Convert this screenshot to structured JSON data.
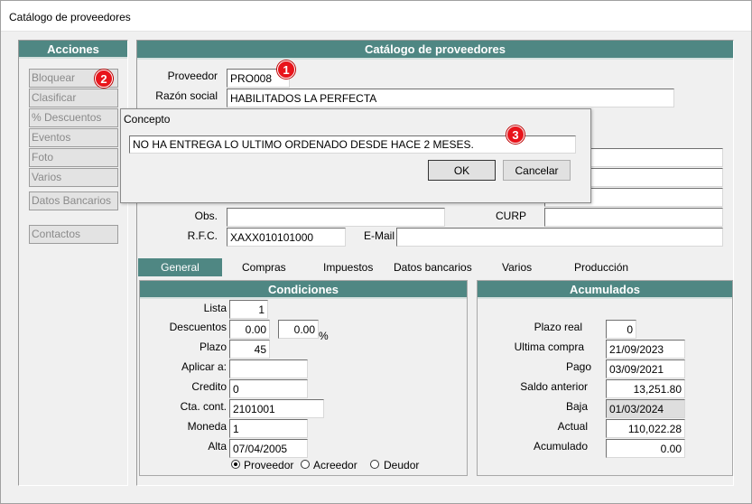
{
  "window": {
    "title": "Catálogo de proveedores"
  },
  "acciones": {
    "title": "Acciones",
    "buttons": [
      "Bloquear",
      "Clasificar",
      "% Descuentos",
      "Eventos",
      "Foto",
      "Varios"
    ],
    "datos_bancarios": "Datos Bancarios",
    "contactos": "Contactos"
  },
  "catalogo": {
    "title": "Catálogo de proveedores",
    "proveedor_label": "Proveedor",
    "proveedor_value": "PRO008",
    "razon_label": "Razón social",
    "razon_value": "HABILITADOS LA PERFECTA",
    "obs_label": "Obs.",
    "obs_value": "",
    "curp_label": "CURP",
    "curp_value": "",
    "rfc_label": "R.F.C.",
    "rfc_value": "XAXX010101000",
    "email_label": "E-Mail",
    "email_value": ""
  },
  "tabs": [
    "General",
    "Compras",
    "Impuestos",
    "Datos bancarios",
    "Varios",
    "Producción"
  ],
  "condiciones": {
    "title": "Condiciones",
    "lista_label": "Lista",
    "lista_value": "1",
    "descuentos_label": "Descuentos",
    "desc1_value": "0.00",
    "desc2_value": "0.00",
    "percent": "%",
    "plazo_label": "Plazo",
    "plazo_value": "45",
    "aplicar_label": "Aplicar a:",
    "aplicar_value": "",
    "credito_label": "Credito",
    "credito_value": "0",
    "cta_label": "Cta. cont.",
    "cta_value": "2101001",
    "moneda_label": "Moneda",
    "moneda_value": "1",
    "alta_label": "Alta",
    "alta_value": "07/04/2005",
    "radio_options": [
      "Proveedor",
      "Acreedor",
      "Deudor"
    ],
    "radio_selected": "Proveedor"
  },
  "acumulados": {
    "title": "Acumulados",
    "plazo_real_label": "Plazo real",
    "plazo_real_value": "0",
    "ultima_compra_label": "Ultima compra",
    "ultima_compra_value": "21/09/2023",
    "pago_label": "Pago",
    "pago_value": "03/09/2021",
    "saldo_label": "Saldo anterior",
    "saldo_value": "13,251.80",
    "baja_label": "Baja",
    "baja_value": "01/03/2024",
    "actual_label": "Actual",
    "actual_value": "110,022.28",
    "acumulado_label": "Acumulado",
    "acumulado_value": "0.00"
  },
  "dialog": {
    "title": "Concepto",
    "input_value": "NO HA ENTREGA LO ULTIMO ORDENADO DESDE HACE 2 MESES.",
    "ok_label": "OK",
    "cancel_label": "Cancelar"
  },
  "badges": [
    "1",
    "2",
    "3"
  ],
  "colors": {
    "header": "#4f8783",
    "badge": "#e8141b"
  }
}
